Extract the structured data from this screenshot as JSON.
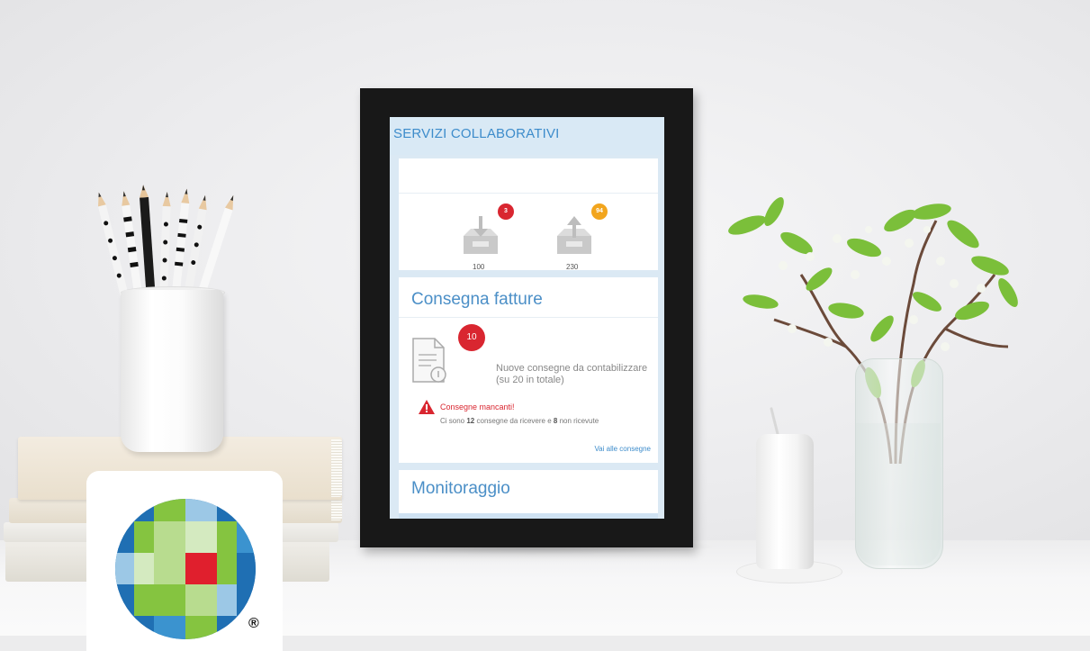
{
  "screen": {
    "title": "SERVIZI COLLABORATIVI",
    "inbox_in": {
      "count": "100",
      "badge": "3"
    },
    "inbox_out": {
      "count": "230",
      "badge": "94"
    },
    "delivery_card": {
      "title": "Consegna fatture",
      "badge": "10",
      "new_line1": "Nuove consegne da contabilizzare",
      "new_line2": "(su 20 in totale)",
      "warning_title": "Consegne mancanti!",
      "warning_prefix": "Ci sono",
      "warning_count_to_receive": "12",
      "warning_middle": "consegne da ricevere e",
      "warning_count_not_received": "8",
      "warning_suffix": "non ricevute",
      "link": "Vai alle consegne"
    },
    "monitor_card": {
      "title": "Monitoraggio"
    }
  },
  "logo": {
    "registered_mark": "®"
  },
  "colors": {
    "accent_blue": "#3d8ccb",
    "badge_red": "#d92630",
    "badge_orange": "#f2a51d",
    "frame": "#181818"
  },
  "icons": [
    "inbox-download-icon",
    "inbox-upload-icon",
    "document-icon",
    "warning-icon",
    "logo-icon"
  ]
}
